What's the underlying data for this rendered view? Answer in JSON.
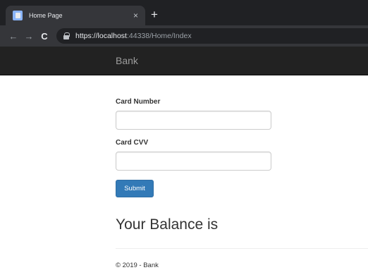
{
  "browser": {
    "tab_title": "Home Page",
    "tab_icon": "page-icon",
    "tab_close": "×",
    "new_tab": "+",
    "nav": {
      "back": "←",
      "forward": "→",
      "reload": "C"
    },
    "url_main": "https://localhost",
    "url_rest": ":44338/Home/Index"
  },
  "navbar": {
    "brand": "Bank"
  },
  "form": {
    "card_number_label": "Card Number",
    "card_number_value": "",
    "card_cvv_label": "Card CVV",
    "card_cvv_value": "",
    "submit_label": "Submit"
  },
  "balance": {
    "heading": "Your Balance is"
  },
  "footer": {
    "text": "© 2019 - Bank"
  },
  "colors": {
    "navbar_bg": "#222222",
    "brand_text": "#9d9d9d",
    "button_primary": "#337ab7"
  }
}
